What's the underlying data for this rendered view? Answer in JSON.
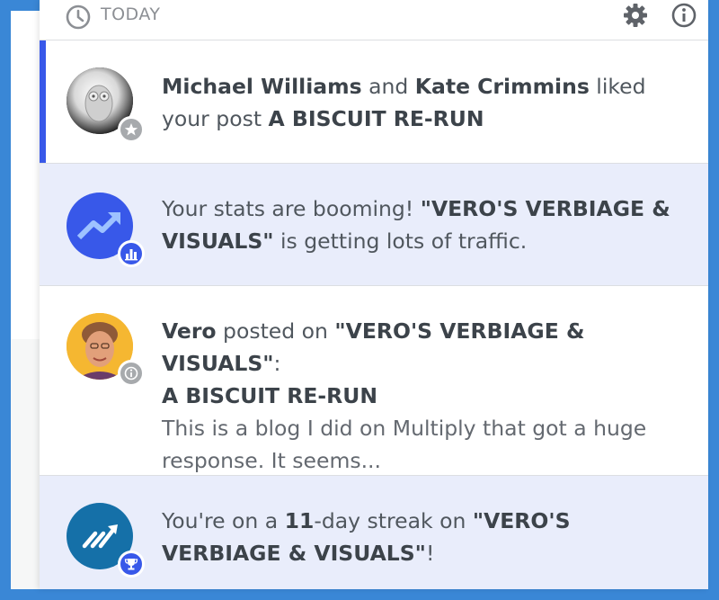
{
  "header": {
    "title": "TODAY",
    "icons": [
      "clock-icon",
      "gear-icon",
      "info-icon"
    ]
  },
  "notifications": [
    {
      "read": true,
      "badge_icon": "star-icon",
      "actor1": "Michael Williams",
      "joiner": " and ",
      "actor2": "Kate Crimmins",
      "verb": " liked your post ",
      "post": "A BISCUIT RE-RUN"
    },
    {
      "read": false,
      "badge_icon": "stats-icon",
      "lead": "Your stats are booming! ",
      "site": "\"VERO'S VERBIAGE & VISUALS\"",
      "tail": " is getting lots of traffic."
    },
    {
      "read": true,
      "badge_icon": "info-icon",
      "actor": "Vero",
      "verb": " posted on ",
      "site": "\"VERO'S VERBIAGE & VISUALS\"",
      "colon": ":",
      "post": "A BISCUIT RE-RUN",
      "excerpt": "This is a blog I did on Multiply that got a huge response. It seems..."
    },
    {
      "read": false,
      "badge_icon": "trophy-icon",
      "lead": "You're on a ",
      "days": "11",
      "mid": "-day streak on ",
      "site": "\"VERO'S VERBIAGE & VISUALS\"",
      "tail": "!"
    }
  ],
  "colors": {
    "frame": "#3a87d6",
    "accent": "#3858e9",
    "unread_bg": "#e9edfb",
    "streak_avatar": "#1570a8",
    "stats_avatar": "#3858e9"
  }
}
